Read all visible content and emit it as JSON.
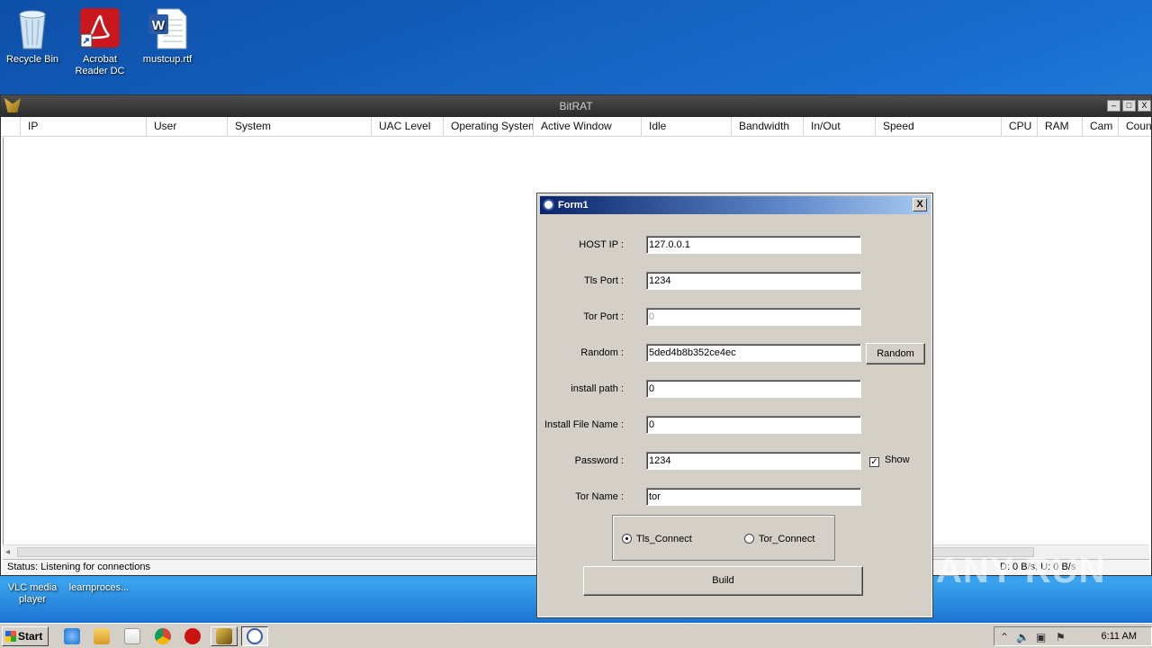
{
  "desktop": {
    "icons": [
      {
        "label": "Recycle Bin"
      },
      {
        "label": "Acrobat Reader DC"
      },
      {
        "label": "mustcup.rtf"
      }
    ],
    "bottom_items": [
      {
        "label": "VLC media player"
      },
      {
        "label": "learnproces..."
      }
    ],
    "watermark": "ANY RUN"
  },
  "bitrat": {
    "title": "BitRAT",
    "controls": [
      "–",
      "□",
      "X"
    ],
    "columns": [
      "",
      "IP",
      "User",
      "System",
      "UAC Level",
      "Operating System",
      "Active Window",
      "Idle",
      "Bandwidth",
      "In/Out",
      "Speed",
      "CPU",
      "RAM",
      "Cam",
      "Count"
    ],
    "status": "Status: Listening for connections",
    "speed": "D: 0 B/s, U: 0 B/s"
  },
  "form1": {
    "title": "Form1",
    "close": "X",
    "fields": [
      {
        "label": "HOST IP :",
        "value": "127.0.0.1"
      },
      {
        "label": "Tls Port :",
        "value": "1234"
      },
      {
        "label": "Tor Port :",
        "value": "0"
      },
      {
        "label": "Random :",
        "value": "5ded4b8b352ce4ec"
      },
      {
        "label": "install path :",
        "value": "0"
      },
      {
        "label": "Install File Name :",
        "value": "0"
      },
      {
        "label": "Password :",
        "value": "1234"
      },
      {
        "label": "Tor Name :",
        "value": "tor"
      }
    ],
    "random_button": "Random",
    "show_checkbox": {
      "label": "Show",
      "checked": true
    },
    "connection": {
      "options": [
        "Tls_Connect",
        "Tor_Connect"
      ],
      "selected": "Tls_Connect"
    },
    "build_button": "Build"
  },
  "taskbar": {
    "start": "Start",
    "clock": "6:11 AM"
  }
}
